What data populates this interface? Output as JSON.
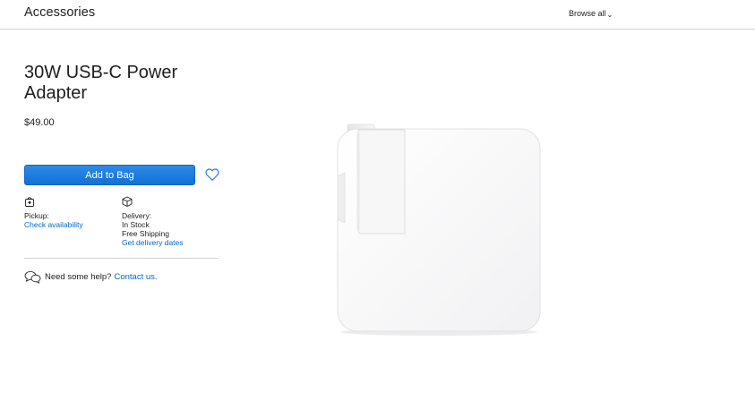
{
  "header": {
    "brand": "Accessories",
    "browse_label": "Browse all",
    "browse_chevron": "⌄"
  },
  "product": {
    "title": "30W USB-C Power Adapter",
    "price": "$49.00",
    "image_icon": "power-adapter-image"
  },
  "actions": {
    "add_to_bag": "Add to Bag",
    "favorite_icon": "heart-icon"
  },
  "pickup": {
    "icon": "store-icon",
    "label": "Pickup:",
    "link": "Check availability"
  },
  "delivery": {
    "icon": "box-icon",
    "label": "Delivery:",
    "stock": "In Stock",
    "shipping": "Free Shipping",
    "link": "Get delivery dates"
  },
  "help": {
    "icon": "chat-bubbles-icon",
    "text": "Need some help?",
    "link": "Contact us."
  },
  "colors": {
    "link": "#0066cc",
    "button": "#1a73d9",
    "text": "#1d1d1f",
    "divider": "#d2d2d7"
  }
}
